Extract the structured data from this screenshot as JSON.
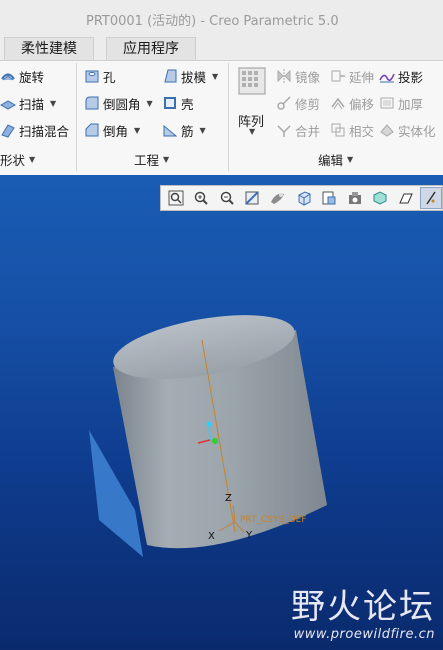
{
  "window": {
    "title": "PRT0001 (活动的) - Creo Parametric 5.0"
  },
  "tabs": [
    {
      "label": "柔性建模"
    },
    {
      "label": "应用程序"
    }
  ],
  "ribbon": {
    "shape": {
      "items": [
        {
          "label": "旋转",
          "icon": "revolve-icon"
        },
        {
          "label": "扫描",
          "icon": "sweep-icon"
        },
        {
          "label": "扫描混合",
          "icon": "swept-blend-icon"
        }
      ],
      "group_label": "形状"
    },
    "engineering": {
      "items": [
        {
          "label": "孔",
          "icon": "hole-icon"
        },
        {
          "label": "倒圆角",
          "icon": "round-icon"
        },
        {
          "label": "倒角",
          "icon": "chamfer-icon"
        },
        {
          "label": "拔模",
          "icon": "draft-icon"
        },
        {
          "label": "壳",
          "icon": "shell-icon"
        },
        {
          "label": "筋",
          "icon": "rib-icon"
        }
      ],
      "group_label": "工程"
    },
    "editing": {
      "pattern_label": "阵列",
      "items": [
        {
          "label": "镜像",
          "icon": "mirror-icon",
          "enabled": false
        },
        {
          "label": "修剪",
          "icon": "trim-icon",
          "enabled": false
        },
        {
          "label": "合并",
          "icon": "merge-icon",
          "enabled": false
        },
        {
          "label": "延伸",
          "icon": "extend-icon",
          "enabled": false
        },
        {
          "label": "偏移",
          "icon": "offset-icon",
          "enabled": false
        },
        {
          "label": "相交",
          "icon": "intersect-icon",
          "enabled": false
        },
        {
          "label": "投影",
          "icon": "project-icon",
          "enabled": true
        },
        {
          "label": "加厚",
          "icon": "thicken-icon",
          "enabled": false
        },
        {
          "label": "实体化",
          "icon": "solidify-icon",
          "enabled": false
        }
      ],
      "group_label": "编辑"
    }
  },
  "view_toolbar": {
    "buttons": [
      "refit-icon",
      "zoom-in-icon",
      "zoom-out-icon",
      "repaint-icon",
      "display-style-icon",
      "saved-orientations-icon",
      "view-manager-icon",
      "perspective-icon",
      "section-icon",
      "annotation-icon",
      "datum-display-icon"
    ]
  },
  "model": {
    "csys_label": "PRT_CSYS_DEF",
    "axis_labels": {
      "x": "X",
      "y": "Y",
      "z": "Z"
    }
  },
  "watermark": {
    "text": "野火论坛",
    "url": "www.proewildfire.cn"
  },
  "colors": {
    "viewport_top": "#1a5cb4",
    "viewport_bottom": "#0a2a6d",
    "model_gray": "#9aa2ab",
    "plane_blue": "#3d7fd0",
    "datum_orange": "#c8822a"
  }
}
